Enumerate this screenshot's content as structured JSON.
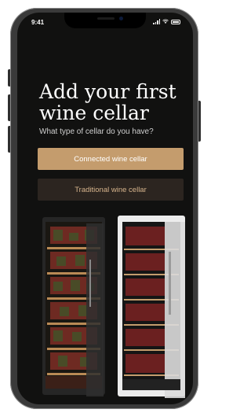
{
  "status_bar": {
    "time": "9:41"
  },
  "onboarding": {
    "title": "Add your first wine cellar",
    "subtitle": "What type of cellar do you have?",
    "connected_label": "Connected wine cellar",
    "traditional_label": "Traditional wine cellar"
  },
  "colors": {
    "background": "#111110",
    "accent": "#c49c6d",
    "secondary_bg": "#2c2520",
    "secondary_text": "#d6b48c"
  },
  "icons": [
    "signal-icon",
    "wifi-icon",
    "battery-icon"
  ]
}
